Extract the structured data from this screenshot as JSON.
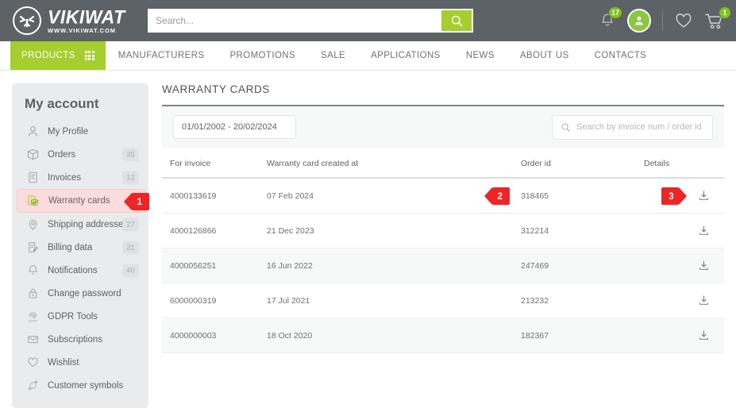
{
  "header": {
    "logo_name": "VIKIWAT",
    "logo_sub": "WWW.VIKIWAT.COM",
    "search_placeholder": "Search...",
    "search_value": "",
    "notifications_count": "17",
    "cart_count": "1"
  },
  "nav": {
    "products_label": "PRODUCTS",
    "links": [
      {
        "label": "MANUFACTURERS"
      },
      {
        "label": "PROMOTIONS"
      },
      {
        "label": "SALE"
      },
      {
        "label": "APPLICATIONS"
      },
      {
        "label": "NEWS"
      },
      {
        "label": "ABOUT US"
      },
      {
        "label": "CONTACTS"
      }
    ]
  },
  "sidebar": {
    "title": "My account",
    "items": [
      {
        "label": "My Profile",
        "badge": "",
        "icon": "user-icon",
        "active": false
      },
      {
        "label": "Orders",
        "badge": "35",
        "icon": "box-icon",
        "active": false
      },
      {
        "label": "Invoices",
        "badge": "12",
        "icon": "invoice-icon",
        "active": false
      },
      {
        "label": "Warranty cards",
        "badge": "",
        "icon": "warranty-shield-icon",
        "active": true
      },
      {
        "label": "Shipping addresses",
        "badge": "27",
        "icon": "location-pin-icon",
        "active": false
      },
      {
        "label": "Billing data",
        "badge": "21",
        "icon": "billing-edit-icon",
        "active": false
      },
      {
        "label": "Notifications",
        "badge": "40",
        "icon": "bell-icon",
        "active": false
      },
      {
        "label": "Change password",
        "badge": "",
        "icon": "lock-icon",
        "active": false
      },
      {
        "label": "GDPR Tools",
        "badge": "",
        "icon": "gdpr-fingerprint-icon",
        "active": false
      },
      {
        "label": "Subscriptions",
        "badge": "",
        "icon": "envelope-icon",
        "active": false
      },
      {
        "label": "Wishlist",
        "badge": "",
        "icon": "heart-icon",
        "active": false
      },
      {
        "label": "Customer symbols",
        "badge": "",
        "icon": "symbols-icon",
        "active": false
      }
    ]
  },
  "main": {
    "title": "WARRANTY CARDS",
    "date_filter": "01/01/2002 - 20/02/2024",
    "search_placeholder": "Search by invoice num / order id",
    "search_value": "",
    "columns": {
      "invoice": "For invoice",
      "created": "Warranty card created at",
      "order": "Order id",
      "details": "Details"
    },
    "rows": [
      {
        "invoice": "4000133619",
        "created": "07 Feb 2024",
        "order": "318465",
        "shade": false
      },
      {
        "invoice": "4000126866",
        "created": "21 Dec 2023",
        "order": "312214",
        "shade": false
      },
      {
        "invoice": "4000056251",
        "created": "16 Jun 2022",
        "order": "247469",
        "shade": true
      },
      {
        "invoice": "6000000319",
        "created": "17 Jul 2021",
        "order": "213232",
        "shade": false
      },
      {
        "invoice": "4000000003",
        "created": "18 Oct 2020",
        "order": "182367",
        "shade": true
      }
    ]
  },
  "markers": {
    "one": "1",
    "two": "2",
    "three": "3"
  },
  "colors": {
    "brand_green": "#a6ce2e",
    "header_gray": "#5d6266",
    "marker_red": "#ef2424",
    "sidebar_bg": "#e9ebec",
    "active_item_bg": "#fbdcdc"
  }
}
